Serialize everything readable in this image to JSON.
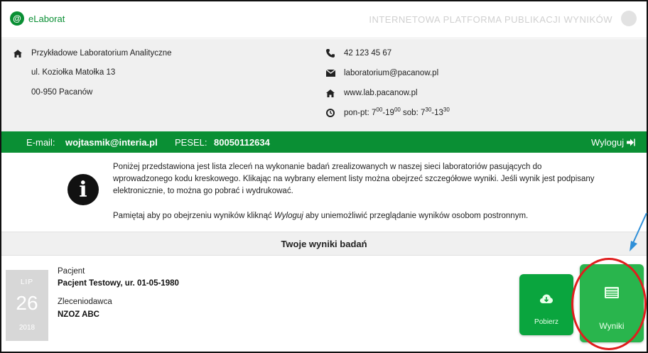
{
  "header": {
    "logo_letter": "@",
    "logo_text": "eLaborat",
    "platform_title": "INTERNETOWA PLATFORMA PUBLIKACJI WYNIKÓW"
  },
  "lab": {
    "name": "Przykładowe Laboratorium Analityczne",
    "street": "ul. Koziołka Matołka 13",
    "city": "00-950 Pacanów",
    "phone": "42 123 45 67",
    "email": "laboratorium@pacanow.pl",
    "website": "www.lab.pacanow.pl",
    "hours": {
      "weekday_prefix": "pon-pt: 7",
      "weekday_open_sup": "00",
      "weekday_sep": "-19",
      "weekday_close_sup": "00",
      "weekend_prefix": " sob: 7",
      "weekend_open_sup": "30",
      "weekend_sep": "-13",
      "weekend_close_sup": "30"
    }
  },
  "userbar": {
    "email_label": "E-mail:",
    "email_value": "wojtasmik@interia.pl",
    "pesel_label": "PESEL:",
    "pesel_value": "80050112634",
    "logout_label": "Wyloguj"
  },
  "info": {
    "paragraph1": "Poniżej przedstawiona jest lista zleceń na wykonanie badań zrealizowanych w naszej sieci laboratoriów pasujących do wprowadzonego kodu kreskowego. Klikając na wybrany element listy można obejrzeć szczegółowe wyniki. Jeśli wynik jest podpisany elektronicznie, to można go pobrać i wydrukować.",
    "paragraph2_before": "Pamiętaj aby po obejrzeniu wyników kliknąć ",
    "paragraph2_em": "Wyloguj",
    "paragraph2_after": " aby uniemożliwić przeglądanie wyników osobom postronnym."
  },
  "results": {
    "section_title": "Twoje wyniki badań",
    "items": [
      {
        "month": "LIP",
        "day": "26",
        "year": "2018",
        "patient_label": "Pacjent",
        "patient_value": "Pacjent Testowy, ur. 01-05-1980",
        "orderer_label": "Zleceniodawca",
        "orderer_value": "NZOZ ABC",
        "download_label": "Pobierz",
        "results_label": "Wyniki"
      }
    ]
  },
  "colors": {
    "brand_green": "#0a8f34",
    "button_green": "#0aa53e",
    "highlight_red": "#e01d1d",
    "arrow_blue": "#2f8fd8"
  }
}
